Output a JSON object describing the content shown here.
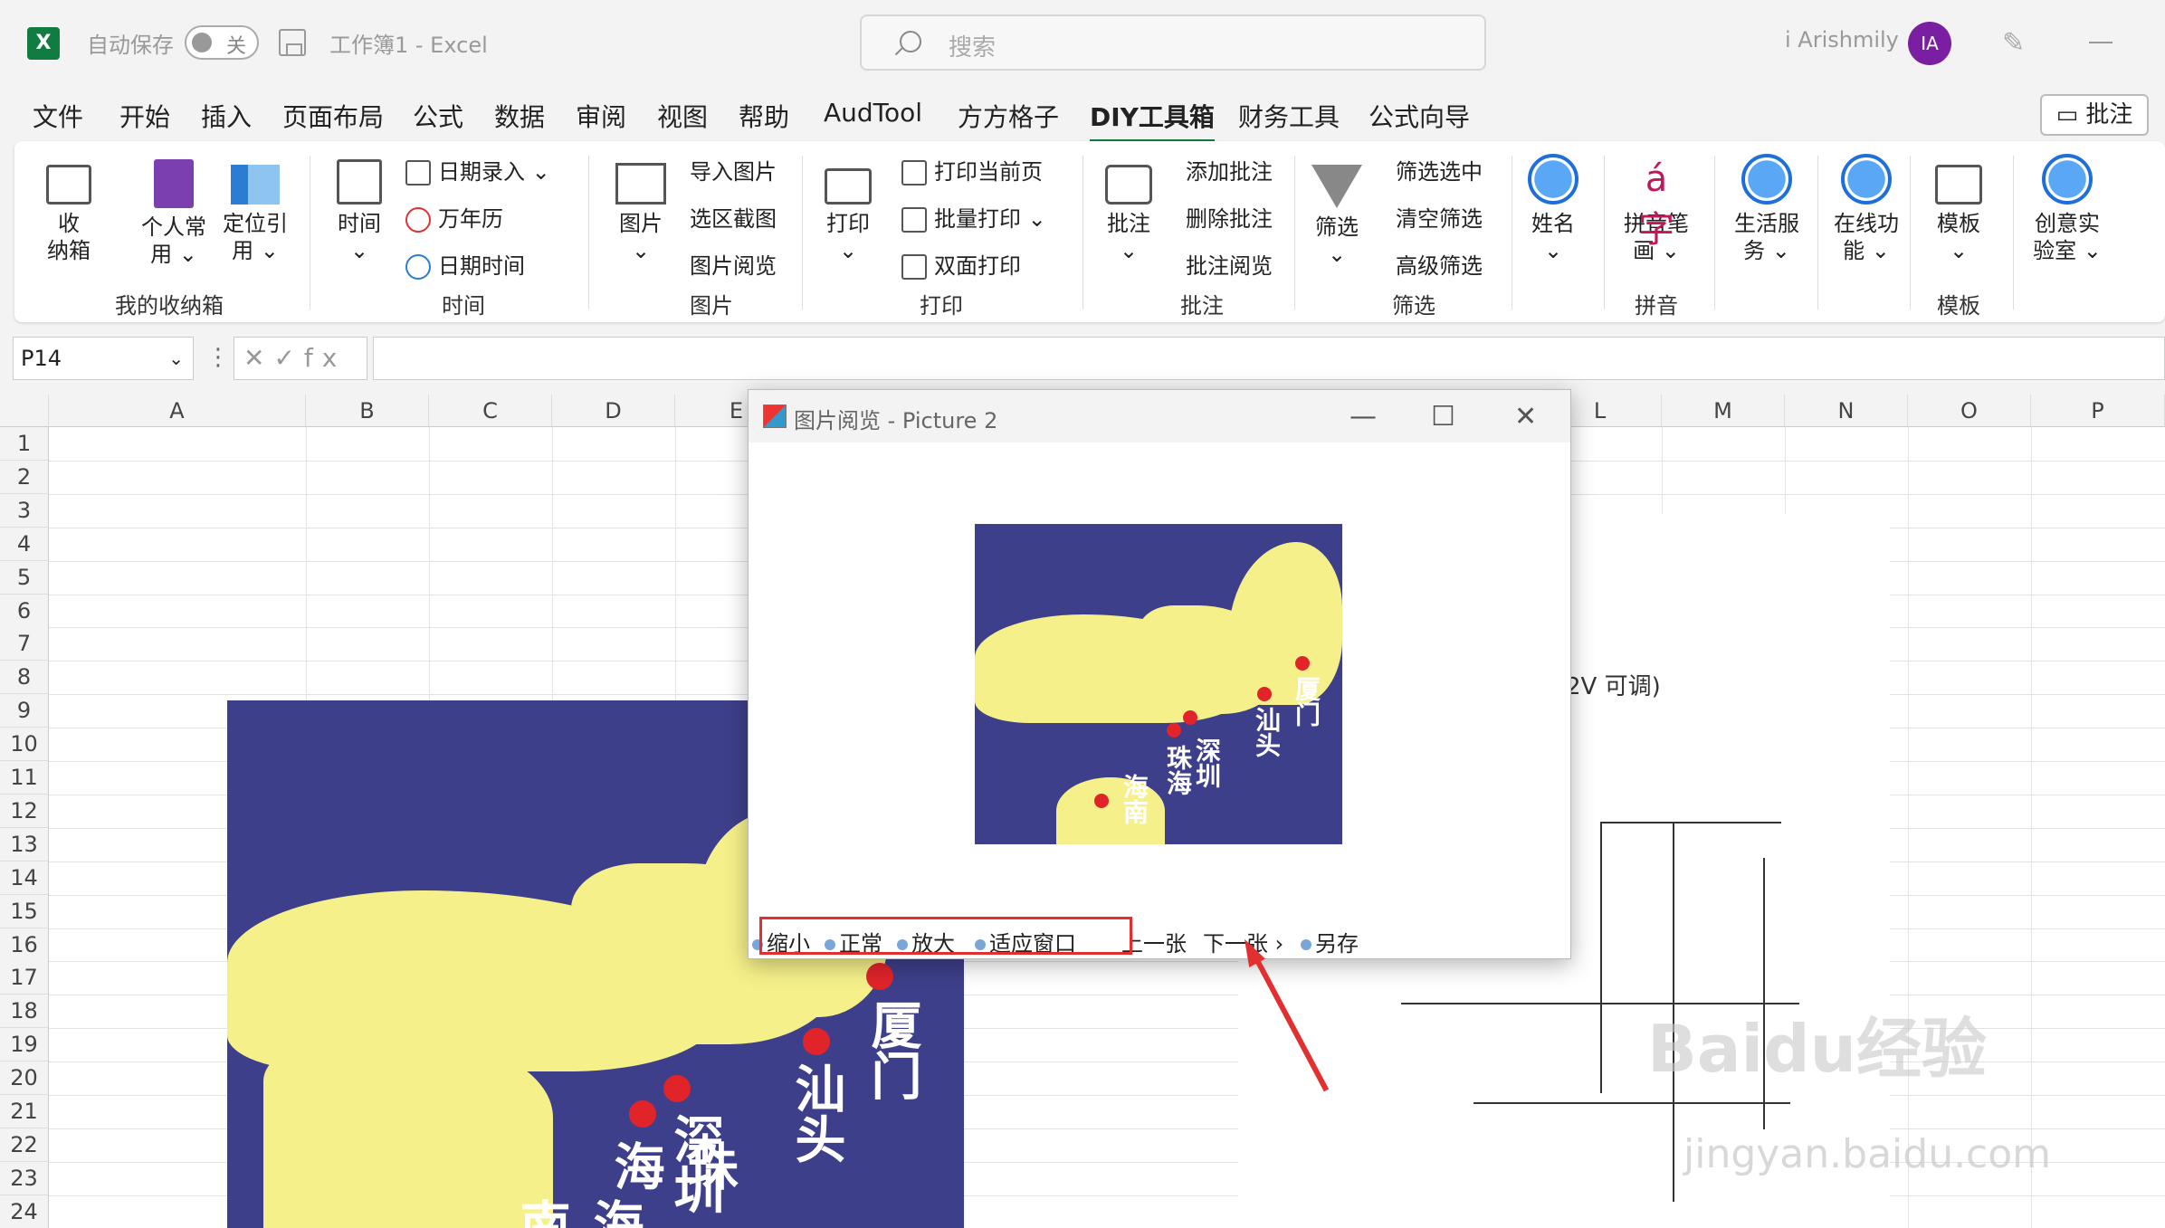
{
  "titlebar": {
    "autosave": "自动保存",
    "toggle_state": "关",
    "doc_title": "工作簿1 - Excel",
    "search_placeholder": "搜索",
    "user_name": "i Arishmily",
    "avatar_initials": "IA"
  },
  "menu": {
    "tabs": [
      "文件",
      "开始",
      "插入",
      "页面布局",
      "公式",
      "数据",
      "审阅",
      "视图",
      "帮助",
      "AudTool",
      "方方格子",
      "DIY工具箱",
      "财务工具",
      "公式向导"
    ],
    "active": "DIY工具箱",
    "comment_button": "批注"
  },
  "ribbon": {
    "groups": {
      "favorites": {
        "label": "我的收纳箱",
        "btn1_a": "收",
        "btn1_b": "纳箱",
        "btn2_a": "个人常",
        "btn2_b": "用 ⌄",
        "btn3_a": "定位引",
        "btn3_b": "用 ⌄"
      },
      "time": {
        "label": "时间",
        "big": "时间",
        "date_entry": "日期录入",
        "calendar": "万年历",
        "date_time": "日期时间"
      },
      "picture": {
        "label": "图片",
        "big": "图片",
        "import": "导入图片",
        "region_shot": "选区截图",
        "browse": "图片阅览"
      },
      "print": {
        "label": "打印",
        "big": "打印",
        "current_page": "打印当前页",
        "batch": "批量打印",
        "duplex": "双面打印"
      },
      "comment": {
        "label": "批注",
        "big": "批注",
        "add": "添加批注",
        "delete": "删除批注",
        "browse": "批注阅览"
      },
      "filter": {
        "label": "筛选",
        "big": "筛选",
        "filter_selected": "筛选选中",
        "clear": "清空筛选",
        "advanced": "高级筛选"
      },
      "name": {
        "big": "姓名"
      },
      "pinyin": {
        "label": "拼音",
        "big_a": "拼音笔",
        "big_b": "画 ⌄"
      },
      "life": {
        "big_a": "生活服",
        "big_b": "务 ⌄"
      },
      "online": {
        "big_a": "在线功",
        "big_b": "能 ⌄"
      },
      "template": {
        "label": "模板",
        "big": "模板"
      },
      "creative": {
        "big_a": "创意实",
        "big_b": "验室 ⌄"
      }
    }
  },
  "formula_bar": {
    "cell_ref": "P14",
    "fx_symbols": "✕✓fx"
  },
  "sheet": {
    "columns": [
      "A",
      "B",
      "C",
      "D",
      "E",
      "L",
      "M",
      "N",
      "O",
      "P"
    ],
    "rows": [
      "1",
      "2",
      "3",
      "4",
      "5",
      "6",
      "7",
      "8",
      "9",
      "10",
      "11",
      "12",
      "13",
      "14",
      "15",
      "16",
      "17",
      "18",
      "19",
      "20",
      "21",
      "22",
      "23",
      "24"
    ]
  },
  "map_labels": {
    "xiamen": "厦门",
    "shantou": "汕头",
    "shenzhen": "深圳",
    "zhuhai": "珠海",
    "hainan": "海南"
  },
  "circuit": {
    "caption": "2V 可调)"
  },
  "watermark": {
    "line1": "Baidu经验",
    "line2": "jingyan.baidu.com"
  },
  "dialog": {
    "title": "图片阅览 - Picture 2",
    "toolbar": [
      "缩小",
      "正常",
      "放大",
      "适应窗口",
      "上一张",
      "下一张",
      "另存"
    ]
  },
  "colors": {
    "excel_green": "#107c41",
    "map_sea": "#3e3f8a",
    "map_land": "#f6f08a",
    "city_dot": "#e0242a",
    "highlight": "#e23030"
  }
}
